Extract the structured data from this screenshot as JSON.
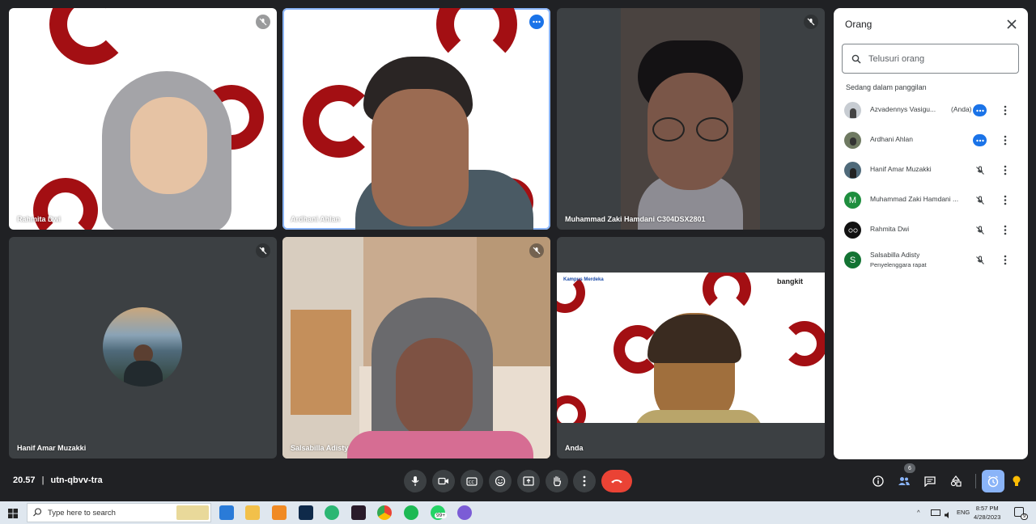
{
  "tiles": [
    {
      "name": "Rahmita Dwi",
      "state": "muted"
    },
    {
      "name": "Ardhani Ahlan",
      "state": "speaking"
    },
    {
      "name": "Muhammad Zaki Hamdani C304DSX2801",
      "state": "muted"
    },
    {
      "name": "Hanif Amar Muzakki",
      "state": "muted"
    },
    {
      "name": "Salsabilla Adisty",
      "state": "muted"
    },
    {
      "name": "Anda",
      "state": "none"
    }
  ],
  "tile_logo": {
    "text": "bangkit",
    "kampus": "Kampus Merdeka"
  },
  "panel": {
    "title": "Orang",
    "search_placeholder": "Telusuri orang",
    "section_label": "Sedang dalam panggilan",
    "people": [
      {
        "name": "Azvadennys Vasigu...",
        "you": "(Anda)",
        "status": "speaking",
        "avatar": "photo"
      },
      {
        "name": "Ardhani Ahlan",
        "status": "speaking",
        "avatar": "photo"
      },
      {
        "name": "Hanif Amar Muzakki",
        "status": "muted",
        "avatar": "photo"
      },
      {
        "name": "Muhammad Zaki Hamdani ...",
        "status": "muted",
        "avatar": "M",
        "avatar_color": "#1e8e3e"
      },
      {
        "name": "Rahmita Dwi",
        "status": "muted",
        "avatar": "photo"
      },
      {
        "name": "Salsabilla Adisty",
        "subtitle": "Penyelenggara rapat",
        "status": "muted",
        "avatar": "S",
        "avatar_color": "#137333"
      }
    ]
  },
  "bottom_bar": {
    "time": "20.57",
    "separator": "|",
    "meeting_code": "utn-qbvv-tra",
    "participants_count": "6",
    "controls": [
      "mic-icon",
      "camera-icon",
      "captions-icon",
      "emoji-icon",
      "present-icon",
      "raise-hand-icon",
      "more-icon",
      "end-call-icon"
    ],
    "right_controls": [
      "info-icon",
      "people-icon",
      "chat-icon",
      "activities-icon",
      "timer-icon",
      "lightbulb-icon"
    ]
  },
  "taskbar": {
    "search_placeholder": "Type here to search",
    "notification_count": "99+",
    "language": "ENG",
    "time": "8:57 PM",
    "date": "4/28/2023",
    "notif_badge": "9"
  },
  "colors": {
    "accent": "#1a73e8",
    "end_call": "#ea4335",
    "brand_red": "#a30f13",
    "background": "#202124"
  }
}
